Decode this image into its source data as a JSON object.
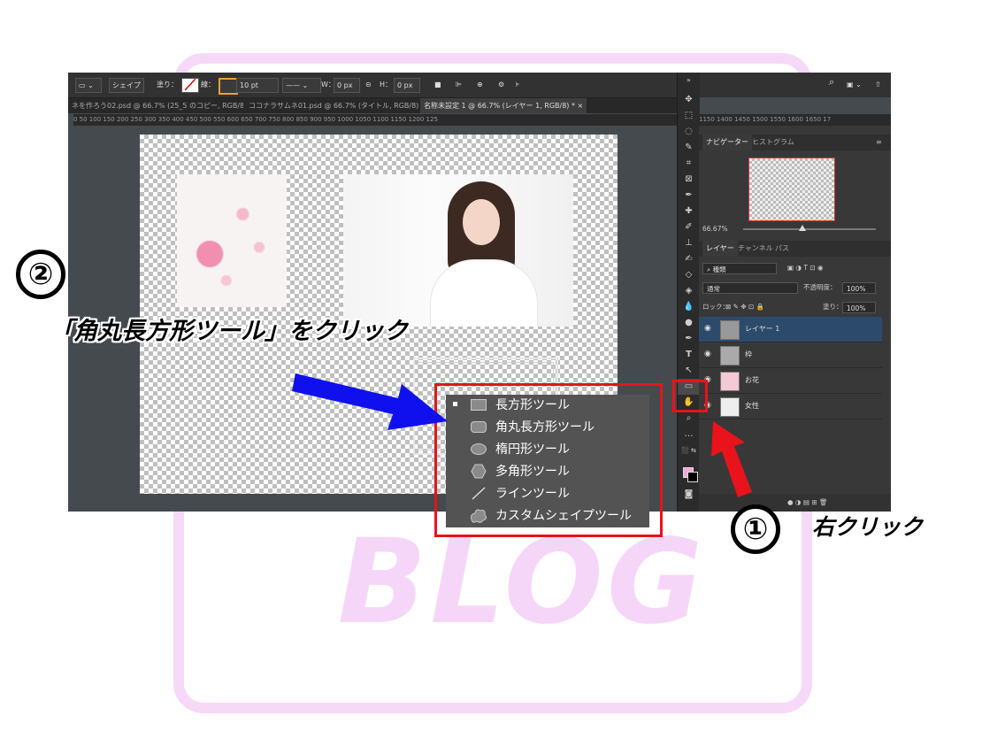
{
  "watermark": {
    "text": "BLOG"
  },
  "options_bar": {
    "shape_mode": "シェイプ",
    "fill_label": "塗り：",
    "stroke_label": "線：",
    "stroke_width": "10 pt",
    "w_label": "W：",
    "w_value": "0 px",
    "h_label": "H：",
    "h_value": "0 px"
  },
  "doc_tabs": [
    {
      "label": "ネを作ろう02.psd @ 66.7% (25_5 のコピー, RGB/8) *"
    },
    {
      "label": "ココナラサムネ01.psd @ 66.7% (タイトル, RGB/8) *"
    },
    {
      "label": "名称未設定 1 @ 66.7% (レイヤー 1, RGB/8) *"
    }
  ],
  "ruler": {
    "left": "0  50  100  150  200  250  300  350  400  450  500  550  600  650  700  750  800  850  900  950  1000  1050  1100  1150  1200  125",
    "right": "1150  1400  1450  1500  1550  1600  1650  17"
  },
  "panels": {
    "top_tabs": [
      "ナビゲーター",
      "ヒストグラム"
    ],
    "zoom": "66.67%",
    "layer_tabs": [
      "レイヤー",
      "チャンネル",
      "パス"
    ],
    "kind": "種類",
    "blend_mode": "通常",
    "opacity_label": "不透明度：",
    "opacity_value": "100%",
    "lock_label": "ロック：",
    "fill_label": "塗り：",
    "fill_value": "100%",
    "layers": [
      {
        "name": "レイヤー 1"
      },
      {
        "name": "枠"
      },
      {
        "name": "お花"
      },
      {
        "name": "女性"
      }
    ]
  },
  "context_menu": {
    "items": [
      {
        "label": "長方形ツール",
        "icon": "rectangle-icon"
      },
      {
        "label": "角丸長方形ツール",
        "icon": "rounded-rectangle-icon"
      },
      {
        "label": "楕円形ツール",
        "icon": "ellipse-icon"
      },
      {
        "label": "多角形ツール",
        "icon": "polygon-icon"
      },
      {
        "label": "ラインツール",
        "icon": "line-icon"
      },
      {
        "label": "カスタムシェイプツール",
        "icon": "custom-shape-icon"
      }
    ]
  },
  "annotations": {
    "step1_number": "①",
    "step1_text": "右クリック",
    "step2_number": "②",
    "step2_text": "「角丸長方形ツール」をクリック",
    "arrow_colors": {
      "blue": "#1010ee",
      "red": "#e8131b"
    },
    "highlight_color": "#e8131b"
  },
  "colors": {
    "foreground": "#f2a7d8",
    "background": "#000000",
    "selected_layer": "#2c4a6b"
  }
}
